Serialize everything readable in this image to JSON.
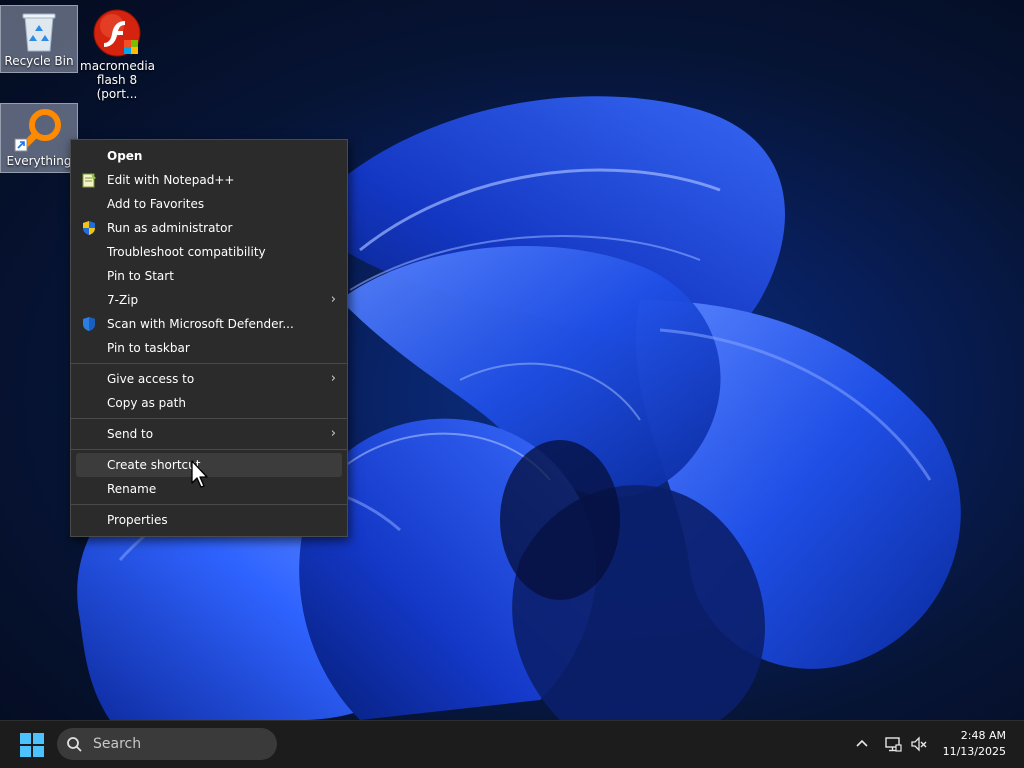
{
  "desktop": {
    "icons": [
      {
        "label": "Recycle Bin",
        "icon": "recycle-bin-icon"
      },
      {
        "label": "macromedia flash 8 (port...",
        "icon": "flash-icon"
      },
      {
        "label": "Everything",
        "icon": "everything-search-icon"
      }
    ]
  },
  "context_menu": {
    "items": [
      {
        "label": "Open"
      },
      {
        "label": "Edit with Notepad++",
        "icon": "notepad-plus-plus-icon"
      },
      {
        "label": "Add to Favorites"
      },
      {
        "label": "Run as administrator",
        "icon": "uac-shield-icon"
      },
      {
        "label": "Troubleshoot compatibility"
      },
      {
        "label": "Pin to Start"
      },
      {
        "label": "7-Zip",
        "submenu": true
      },
      {
        "label": "Scan with Microsoft Defender...",
        "icon": "defender-shield-icon"
      },
      {
        "label": "Pin to taskbar"
      },
      {
        "label": "Give access to",
        "submenu": true
      },
      {
        "label": "Copy as path"
      },
      {
        "label": "Send to",
        "submenu": true
      },
      {
        "label": "Create shortcut",
        "hovered": true
      },
      {
        "label": "Rename"
      },
      {
        "label": "Properties"
      }
    ],
    "chevron": "›"
  },
  "taskbar": {
    "start_icon": "windows-logo-icon",
    "search_placeholder": "Search",
    "tray": {
      "overflow_icon": "chevron-up-icon",
      "network_icon": "network-icon",
      "volume_icon": "volume-muted-icon"
    },
    "clock": {
      "time": "2:48 AM",
      "date": "11/13/2025"
    }
  },
  "colors": {
    "menu_bg": "#2b2b2b",
    "menu_hover": "#3c3c3c",
    "taskbar_bg": "#1c1c1c",
    "accent": "#0078d4"
  }
}
